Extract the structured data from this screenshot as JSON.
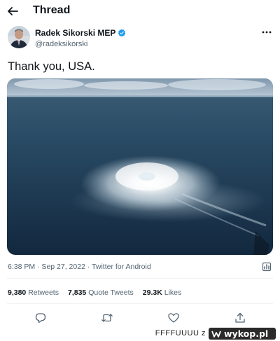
{
  "header": {
    "title": "Thread"
  },
  "tweet": {
    "author_name": "Radek Sikorski MEP",
    "handle": "@radeksikorski",
    "text": "Thank you, USA.",
    "timestamp": "6:38 PM · Sep 27, 2022 · Twitter for Android"
  },
  "stats": {
    "retweets_count": "9,380",
    "retweets_label": "Retweets",
    "quotes_count": "7,835",
    "quotes_label": "Quote Tweets",
    "likes_count": "29.3K",
    "likes_label": "Likes"
  },
  "icons": {
    "back": "arrow-left-icon",
    "verified": "verified-badge-icon",
    "more": "more-horizontal-icon",
    "analytics": "analytics-icon",
    "reply": "reply-icon",
    "retweet": "retweet-icon",
    "like": "heart-icon",
    "share": "share-icon"
  },
  "colors": {
    "verified": "#1d9bf0",
    "text_primary": "#0f1419",
    "text_secondary": "#536471",
    "divider": "#eff3f4"
  },
  "watermark": {
    "user": "FFFFUUUU z",
    "logo": "wykop.pl"
  }
}
